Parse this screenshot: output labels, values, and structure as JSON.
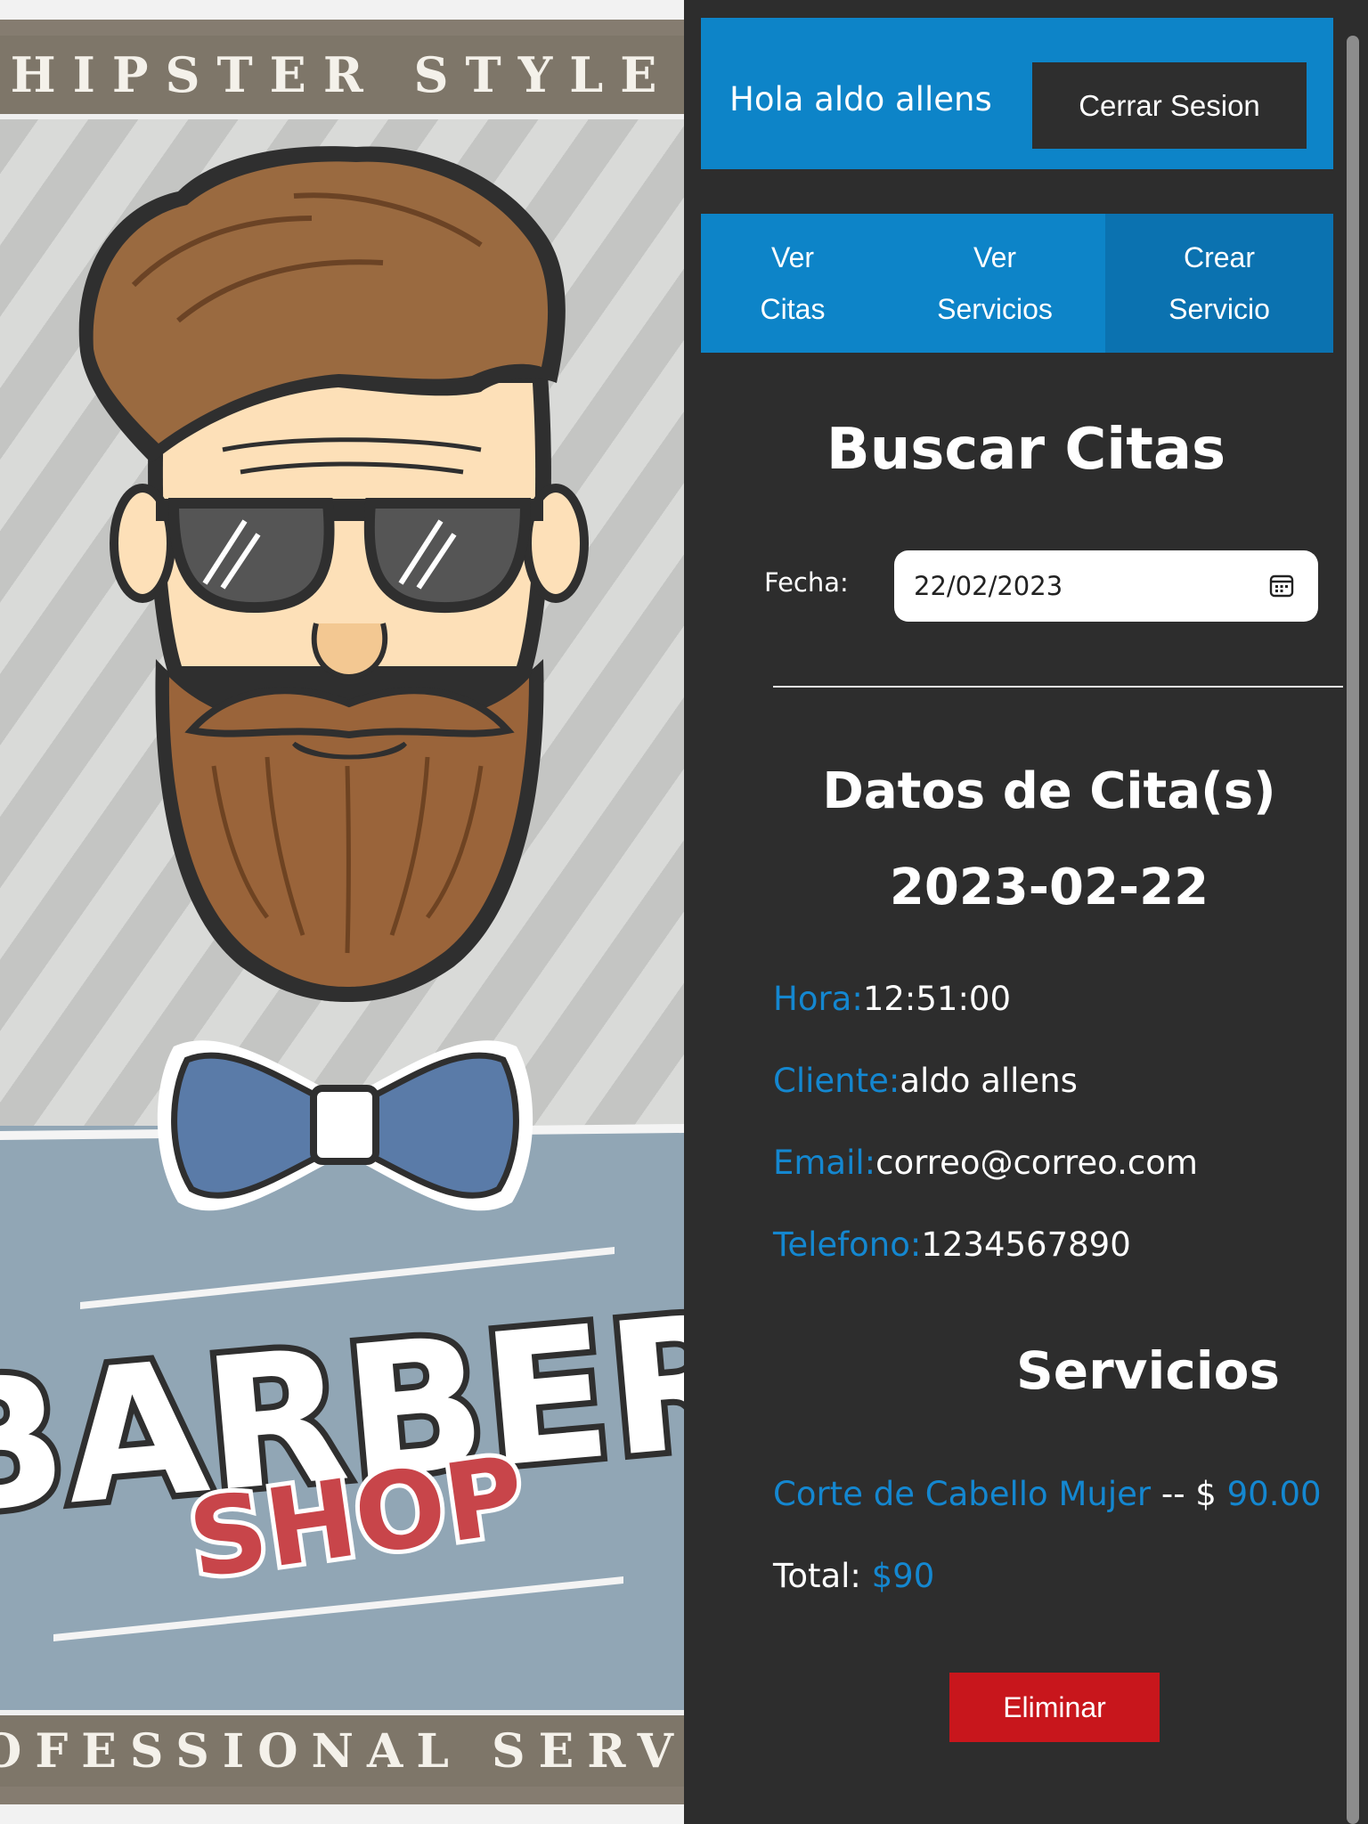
{
  "poster": {
    "top_banner": "HIPSTER STYLE",
    "bottom_banner": "PROFESSIONAL SERVICE",
    "barber_text": "BARBER",
    "shop_text": "SHOP"
  },
  "header": {
    "greeting": "Hola aldo allens",
    "logout_label": "Cerrar Sesion"
  },
  "nav": {
    "tabs": [
      {
        "line1": "Ver",
        "line2": "Citas"
      },
      {
        "line1": "Ver",
        "line2": "Servicios"
      },
      {
        "line1": "Crear",
        "line2": "Servicio"
      }
    ]
  },
  "search": {
    "title": "Buscar Citas",
    "date_label": "Fecha:",
    "date_value": "22/02/2023"
  },
  "appointment": {
    "title": "Datos de Cita(s) 2023-02-22",
    "fields": [
      {
        "label": "Hora:",
        "value": "12:51:00"
      },
      {
        "label": "Cliente:",
        "value": "aldo allens"
      },
      {
        "label": "Email:",
        "value": "correo@correo.com"
      },
      {
        "label": "Telefono:",
        "value": "1234567890"
      }
    ]
  },
  "services": {
    "title": "Servicios",
    "items": [
      {
        "name": "Corte de Cabello Mujer",
        "separator": " -- $ ",
        "price": "90.00"
      }
    ],
    "total_label": "Total: ",
    "total_value": "$90"
  },
  "actions": {
    "delete_label": "Eliminar"
  },
  "colors": {
    "accent_blue": "#0d84c8",
    "panel_bg": "#2d2d2d",
    "danger": "#c8161c",
    "label_blue": "#1487d0"
  }
}
